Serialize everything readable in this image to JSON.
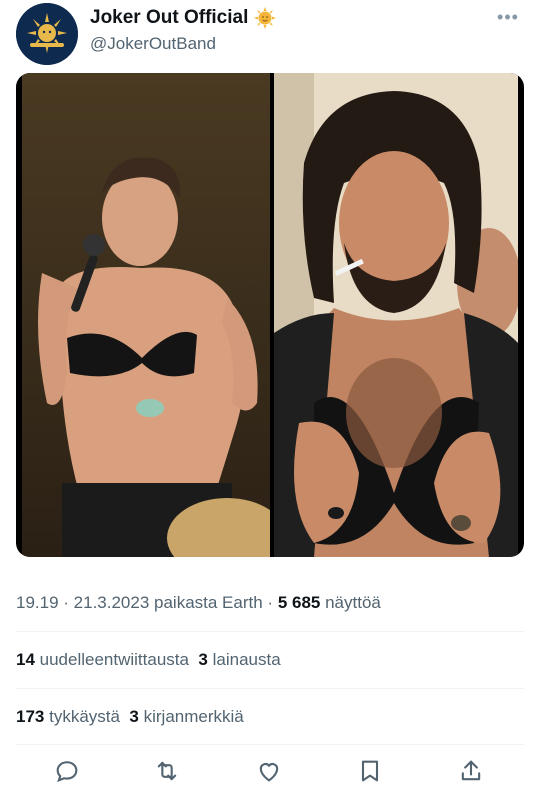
{
  "author": {
    "display_name": "Joker Out Official",
    "handle": "@JokerOutBand",
    "badge_icon": "sun-emoji-icon",
    "avatar_icon": "sun-logo-icon"
  },
  "more_icon": "more-options-icon",
  "more_glyph": "•••",
  "media": {
    "photo_left_icon": "photo",
    "photo_right_icon": "photo"
  },
  "meta": {
    "time": "19.19",
    "sep1": " · ",
    "date": "21.3.2023",
    "source": " paikasta Earth",
    "sep2": " · ",
    "views_count": "5 685",
    "views_label": " näyttöä"
  },
  "stats_row1": {
    "retweets_count": "14",
    "retweets_label": " uudelleentwiittausta",
    "quotes_count": "3",
    "quotes_label": " lainausta"
  },
  "stats_row2": {
    "likes_count": "173",
    "likes_label": " tykkäystä",
    "bookmarks_count": "3",
    "bookmarks_label": " kirjanmerkkiä"
  },
  "actions": [
    "reply-icon",
    "retweet-icon",
    "like-icon",
    "bookmark-icon",
    "share-icon"
  ],
  "colors": {
    "text": "#0f1419",
    "secondary": "#536471",
    "divider": "#eff3f4",
    "avatar_bg": "#0e2a4e",
    "avatar_logo": "#e8b84a"
  }
}
